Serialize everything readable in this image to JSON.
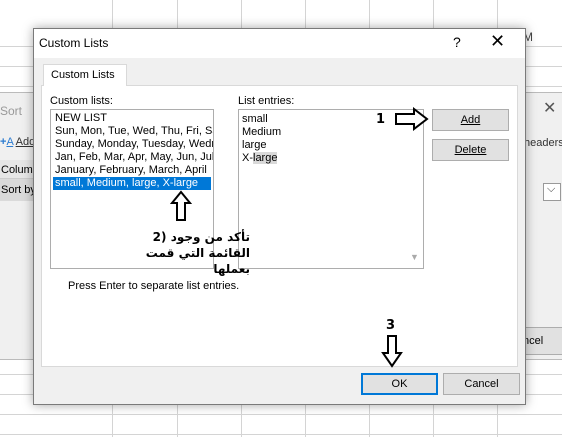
{
  "sheet": {
    "column_label": "M"
  },
  "sort_dialog": {
    "title": "Sort",
    "close_glyph": "✕",
    "add_level": "Add",
    "add_level_prefix": "A",
    "headers": "headers",
    "column_header": "Column",
    "sort_by": "Sort by",
    "cancel": "ncel"
  },
  "dialog": {
    "title": "Custom Lists",
    "help": "?",
    "close": "✕",
    "tab_label": "Custom Lists",
    "custom_lists_label": "Custom lists:",
    "list_entries_label": "List entries:",
    "custom_lists": [
      "NEW LIST",
      "Sun, Mon, Tue, Wed, Thu, Fri, Sat",
      "Sunday, Monday, Tuesday, Wednesday",
      "Jan, Feb, Mar, Apr, May, Jun, Jul",
      "January, February, March, April",
      "small, Medium, large, X-large"
    ],
    "selected_index": 5,
    "entries": [
      "small",
      "Medium",
      "large",
      "X-",
      "large"
    ],
    "add_button": "Add",
    "delete_button": "Delete",
    "hint": "Press Enter to separate list entries.",
    "ok_button": "OK",
    "cancel_button": "Cancel"
  },
  "annotations": {
    "step1": "1",
    "step2_line1": "تأكد من وجود  (2",
    "step2_line2": "القائمة التي قمت بعملها",
    "step3": "3"
  }
}
